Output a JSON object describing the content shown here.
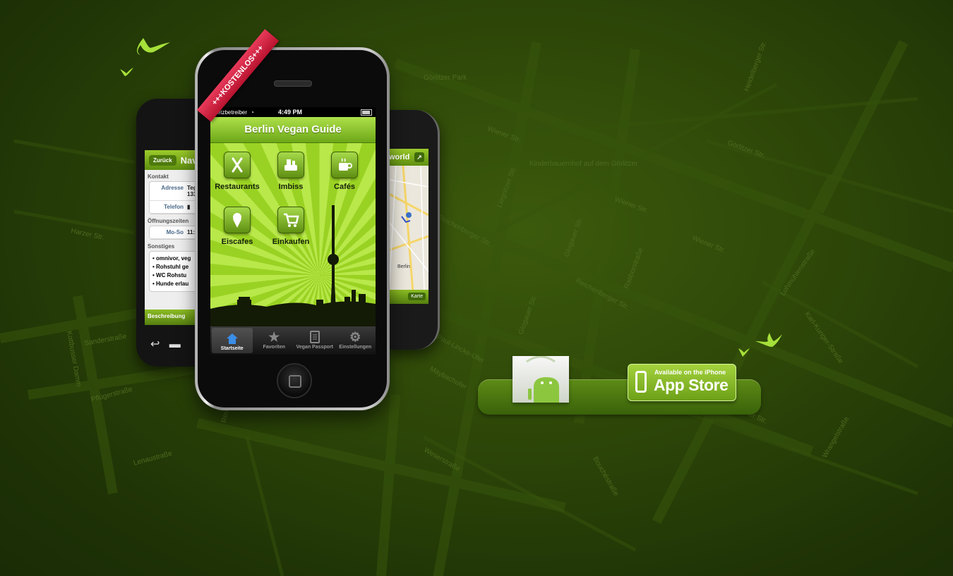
{
  "map": {
    "streets": [
      "Görlitzer Str.",
      "Wiener Str.",
      "Reichenberger Str.",
      "Glogauer Str.",
      "Liegnitzer Str.",
      "Ratiborstraße",
      "Pücklerstraße",
      "Lohmühlenstraße",
      "Karl-Kunger-Straße",
      "Paul-Lincke-Ufer",
      "Maybachufer",
      "Sanderstraße",
      "Pflügerstraße",
      "Kottbusser Damm",
      "Reuterstraße",
      "Lenaustraße",
      "Skalitzer Str.",
      "Forster Str.",
      "Wrangelstraße",
      "Bouchéstraße",
      "Harzer Str.",
      "Weserstraße",
      "Heidelberger Str."
    ],
    "places": [
      "Görlitzer Park",
      "Kinderbauernhof auf dem Görlitzer"
    ]
  },
  "ribbon": "+++KOSTENLOS+++",
  "main_phone": {
    "status": {
      "carrier": "Netzbetreiber",
      "time": "4:49 PM"
    },
    "title": "Berlin Vegan Guide",
    "tiles": [
      "Restaurants",
      "Imbiss",
      "Cafés",
      "Eiscafes",
      "Einkaufen"
    ],
    "tabs": [
      "Startseite",
      "Favoriten",
      "Vegan Passport",
      "Einstellungen"
    ]
  },
  "left_phone": {
    "back": "Zurück",
    "title": "Nave",
    "section_contact": "Kontakt",
    "address_label": "Adresse",
    "address_value_1": "Teg",
    "address_value_2": "133",
    "phone_label": "Telefon",
    "section_hours": "Öffnungszeiten",
    "hours_label": "Mo-So",
    "hours_value": "11:",
    "section_other": "Sonstiges",
    "other_items": [
      "omnivor, veg",
      "Rohstuhl ge",
      "WC Rohstu",
      "Hunde erlau"
    ],
    "tab": "Beschreibung"
  },
  "right_phone": {
    "title": "world",
    "city": "Berlin",
    "tab": "Karte"
  },
  "store": {
    "appstore_small": "Available on the iPhone",
    "appstore_big": "App Store"
  }
}
